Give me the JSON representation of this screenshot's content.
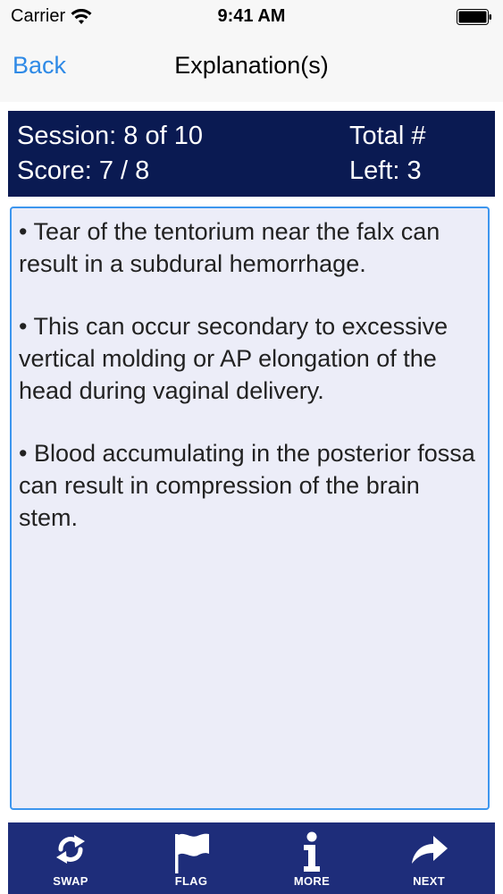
{
  "status_bar": {
    "carrier": "Carrier",
    "time": "9:41 AM"
  },
  "nav": {
    "back_label": "Back",
    "title": "Explanation(s)"
  },
  "session": {
    "session_text": "Session: 8 of 10",
    "score_text": "Score: 7 / 8",
    "total_text": "Total #",
    "left_text": "Left: 3"
  },
  "explanation": {
    "paragraphs": [
      "• Tear of the tentorium near the falx can result in a subdural hemorrhage.",
      "•  This can occur secondary to excessive vertical molding or AP elongation of the head during vaginal delivery.",
      "•  Blood accumulating in the posterior fossa can result in compression of the brain stem."
    ]
  },
  "toolbar": {
    "swap_label": "SWAP",
    "flag_label": "FLAG",
    "more_label": "MORE",
    "next_label": "NEXT",
    "icons": [
      "swap-icon",
      "flag-icon",
      "info-icon",
      "forward-arrow-icon"
    ]
  },
  "colors": {
    "header_bg": "#0a1a52",
    "toolbar_bg": "#1e2d7a",
    "accent_blue": "#2f8ae6",
    "panel_bg": "#ecedf8"
  }
}
